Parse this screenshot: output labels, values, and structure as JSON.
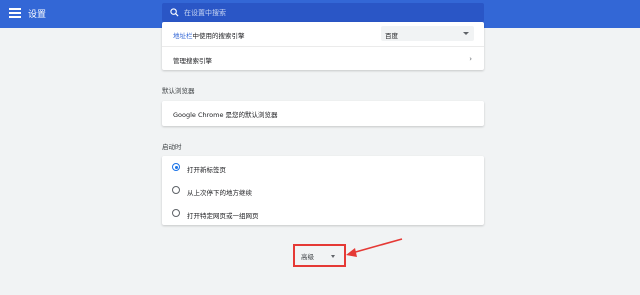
{
  "header": {
    "title": "设置",
    "search_placeholder": "在设置中搜索"
  },
  "search_engine": {
    "label_link": "地址栏",
    "label_rest": "中使用的搜索引擎",
    "selected": "百度",
    "manage_label": "管理搜索引擎"
  },
  "default_browser": {
    "title": "默认浏览器",
    "status": "Google Chrome 是您的默认浏览器"
  },
  "startup": {
    "title": "启动时",
    "options": [
      {
        "label": "打开新标签页",
        "selected": true
      },
      {
        "label": "从上次停下的地方继续",
        "selected": false
      },
      {
        "label": "打开特定网页或一组网页",
        "selected": false
      }
    ]
  },
  "advanced": {
    "label": "高级",
    "highlight_color": "#e53935"
  },
  "colors": {
    "header": "#3367d6",
    "accent": "#1a73e8",
    "annotation": "#e53935"
  }
}
